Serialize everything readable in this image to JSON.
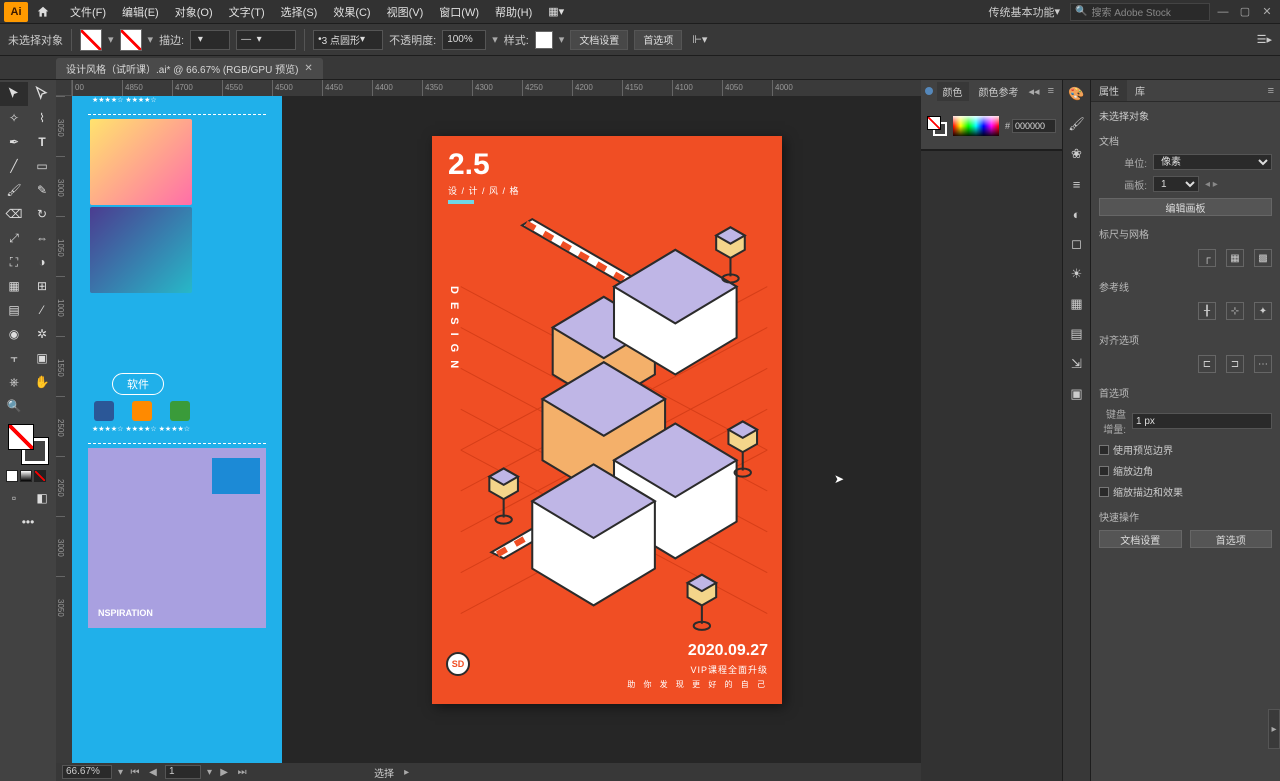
{
  "menubar": {
    "logo": "Ai",
    "items": [
      "文件(F)",
      "编辑(E)",
      "对象(O)",
      "文字(T)",
      "选择(S)",
      "效果(C)",
      "视图(V)",
      "窗口(W)",
      "帮助(H)"
    ],
    "workspace": "传统基本功能",
    "search_placeholder": "搜索 Adobe Stock"
  },
  "optionsbar": {
    "no_selection": "未选择对象",
    "stroke_label": "描边:",
    "stroke_style": "3 点圆形",
    "opacity_label": "不透明度:",
    "opacity_value": "100%",
    "style_label": "样式:",
    "doc_setup": "文档设置",
    "prefs": "首选项"
  },
  "document_tab": {
    "title": "设计风格（试听课）.ai* @ 66.67% (RGB/GPU 预览)"
  },
  "ruler": {
    "h": [
      "00",
      "4850",
      "4700",
      "4550",
      "4500",
      "4450",
      "4400",
      "4350",
      "4300",
      "4250",
      "4200",
      "4150",
      "4100",
      "4050",
      "4000"
    ],
    "v": [
      "3050",
      "3000",
      "1050",
      "1000",
      "1550",
      "2500",
      "2050",
      "3000",
      "3050"
    ]
  },
  "blue_sidebar": {
    "stars1": "★★★★☆   ★★★★☆",
    "software_btn": "软件",
    "stars2": "★★★★☆   ★★★★☆   ★★★★☆",
    "inspiration": "NSPIRATION"
  },
  "artboard": {
    "num": "2.5",
    "sub": "设 / 计 / 风 / 格",
    "design": "DESIGN",
    "date": "2020.09.27",
    "vip": "VIP课程全面升级",
    "foot": "助 你 发 现 更 好 的 自 己",
    "sd": "SD"
  },
  "color_panel": {
    "tab1": "颜色",
    "tab2": "颜色参考",
    "hash": "#",
    "hex": "000000"
  },
  "props_panel": {
    "tab1": "属性",
    "tab2": "库",
    "no_sel": "未选择对象",
    "doc_section": "文档",
    "unit_label": "单位:",
    "unit_value": "像素",
    "artboard_label": "画板:",
    "artboard_value": "1",
    "edit_artboard": "编辑画板",
    "ruler_grid": "标尺与网格",
    "guides": "参考线",
    "align_opts": "对齐选项",
    "prefs_section": "首选项",
    "key_inc_label": "键盘增量:",
    "key_inc_value": "1 px",
    "chk1": "使用预览边界",
    "chk2": "缩放边角",
    "chk3": "缩放描边和效果",
    "quick_section": "快速操作",
    "btn1": "文档设置",
    "btn2": "首选项"
  },
  "statusbar": {
    "zoom": "66.67%",
    "artboard_nav": "1",
    "status": "选择"
  }
}
